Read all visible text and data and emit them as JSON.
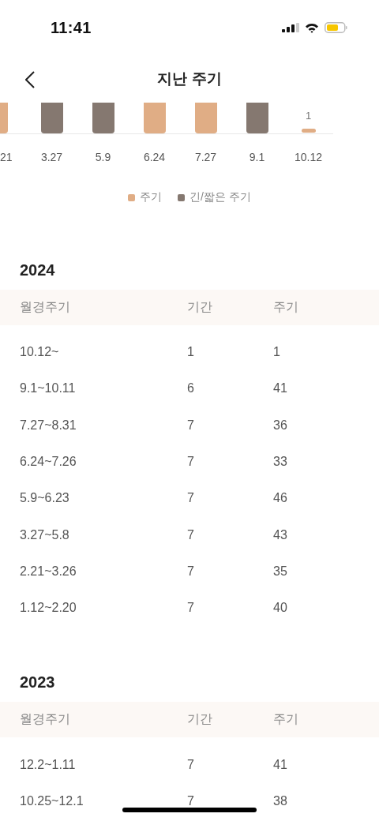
{
  "status_bar": {
    "time": "11:41"
  },
  "header": {
    "title": "지난 주기"
  },
  "chart": {
    "bars": [
      {
        "date": "21",
        "kind": "cycle",
        "partial": true
      },
      {
        "date": "3.27",
        "kind": "long_short",
        "partial": false
      },
      {
        "date": "5.9",
        "kind": "long_short",
        "partial": false
      },
      {
        "date": "6.24",
        "kind": "cycle",
        "partial": false
      },
      {
        "date": "7.27",
        "kind": "cycle",
        "partial": false
      },
      {
        "date": "9.1",
        "kind": "long_short",
        "partial": false
      },
      {
        "date": "10.12",
        "kind": "cycle",
        "partial": false,
        "value_label": "1"
      }
    ],
    "legend": [
      {
        "kind": "cycle",
        "label": "주기",
        "color": "#e0ad85"
      },
      {
        "kind": "long_short",
        "label": "긴/짧은 주기",
        "color": "#857870"
      }
    ]
  },
  "sections": [
    {
      "year": "2024",
      "columns": [
        "월경주기",
        "기간",
        "주기"
      ],
      "rows": [
        [
          "10.12~",
          "1",
          "1"
        ],
        [
          "9.1~10.11",
          "6",
          "41"
        ],
        [
          "7.27~8.31",
          "7",
          "36"
        ],
        [
          "6.24~7.26",
          "7",
          "33"
        ],
        [
          "5.9~6.23",
          "7",
          "46"
        ],
        [
          "3.27~5.8",
          "7",
          "43"
        ],
        [
          "2.21~3.26",
          "7",
          "35"
        ],
        [
          "1.12~2.20",
          "7",
          "40"
        ]
      ]
    },
    {
      "year": "2023",
      "columns": [
        "월경주기",
        "기간",
        "주기"
      ],
      "rows": [
        [
          "12.2~1.11",
          "7",
          "41"
        ],
        [
          "10.25~12.1",
          "7",
          "38"
        ]
      ]
    }
  ]
}
